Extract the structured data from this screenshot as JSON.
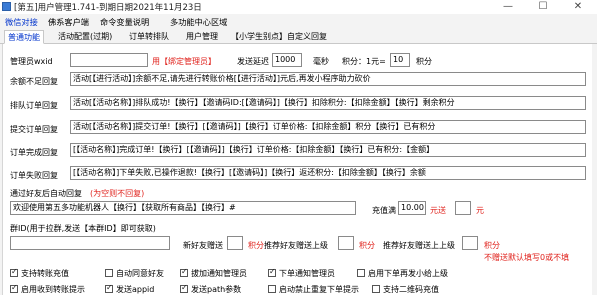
{
  "window": {
    "title": "[第五]用户管理1.741-到期日期2021年11月23日",
    "min_glyph": "—",
    "max_glyph": "☐",
    "close_glyph": "✕"
  },
  "menu": [
    "微信对接",
    "佛系客户端",
    "命令变量说明",
    "多功能中心区域"
  ],
  "tabs": [
    "普通功能",
    "活动配置(过期)",
    "订单转排队",
    "用户管理",
    "【小学生别点】自定义回复"
  ],
  "admin": {
    "label": "管理员wxid",
    "value": "",
    "bind_hint": "用【绑定管理员】",
    "delay_label": "发送延迟",
    "delay_value": "1000",
    "ms": "毫秒",
    "points_label": "积分：1元=",
    "points_value": "10",
    "points_unit": "积分"
  },
  "replies": [
    {
      "label": "余额不足回复",
      "value": "活动[【进行活动】]余额不足,请先进行转账价格[【进行活动】]元后,再发小程序助力砍价"
    },
    {
      "label": "排队订单回复",
      "value": "活动[【活动名称】]排队成功!【换行】【邀请码ID:[【邀请码】]【换行】扣除积分:【扣除金额】【换行】剩余积分"
    },
    {
      "label": "提交订单回复",
      "value": "活动[【活动名称】]提交订单!【换行】[【邀请码】]【换行】订单价格:【扣除金额】积分【换行】已有积分"
    },
    {
      "label": "订单完成回复",
      "value": "[【活动名称】]完成订单!【换行】[【邀请码】]【换行】订单价格:【扣除金额】【换行】已有积分:【金额】"
    },
    {
      "label": "订单失败回复",
      "value": "[【活动名称】]下单失败,已操作退款!【换行】[【邀请码】]【换行】返还积分:【扣除金额】【换行】余额"
    }
  ],
  "friend": {
    "label": "通过好友后自动回复",
    "hint": "(为空则不回复)",
    "value": "欢迎使用第五多功能机器人【换行】【获取所有商品】【换行】#",
    "recharge_label": "充值满",
    "recharge_value": "10.00",
    "yuan_send": "元送",
    "bonus_value": "",
    "yuan": "元"
  },
  "group": {
    "label": "群ID(用于拉群,发送【本群ID】即可获取)",
    "value": "",
    "new_friend_label": "新好友赠送",
    "new_friend_value": "",
    "points": "积分",
    "recommend1_label": "推荐好友赠送上级",
    "recommend1_value": "",
    "recommend2_label": "推荐好友赠送上上级",
    "recommend2_value": "",
    "warning": "不赠送默认填写0或不填"
  },
  "checkboxes": [
    {
      "label": "支持转账充值",
      "checked": true
    },
    {
      "label": "自动同意好友",
      "checked": false
    },
    {
      "label": "拔加通知管理员",
      "checked": true
    },
    {
      "label": "下单通知管理员",
      "checked": true
    },
    {
      "label": "启用下单再发小给上级",
      "checked": false
    },
    {
      "label": "启用收到转账提示",
      "checked": true
    },
    {
      "label": "发送appid",
      "checked": true
    },
    {
      "label": "发送path参数",
      "checked": true
    },
    {
      "label": "启动禁止重复下单提示",
      "checked": false
    },
    {
      "label": "支持二维码充值",
      "checked": false
    }
  ]
}
